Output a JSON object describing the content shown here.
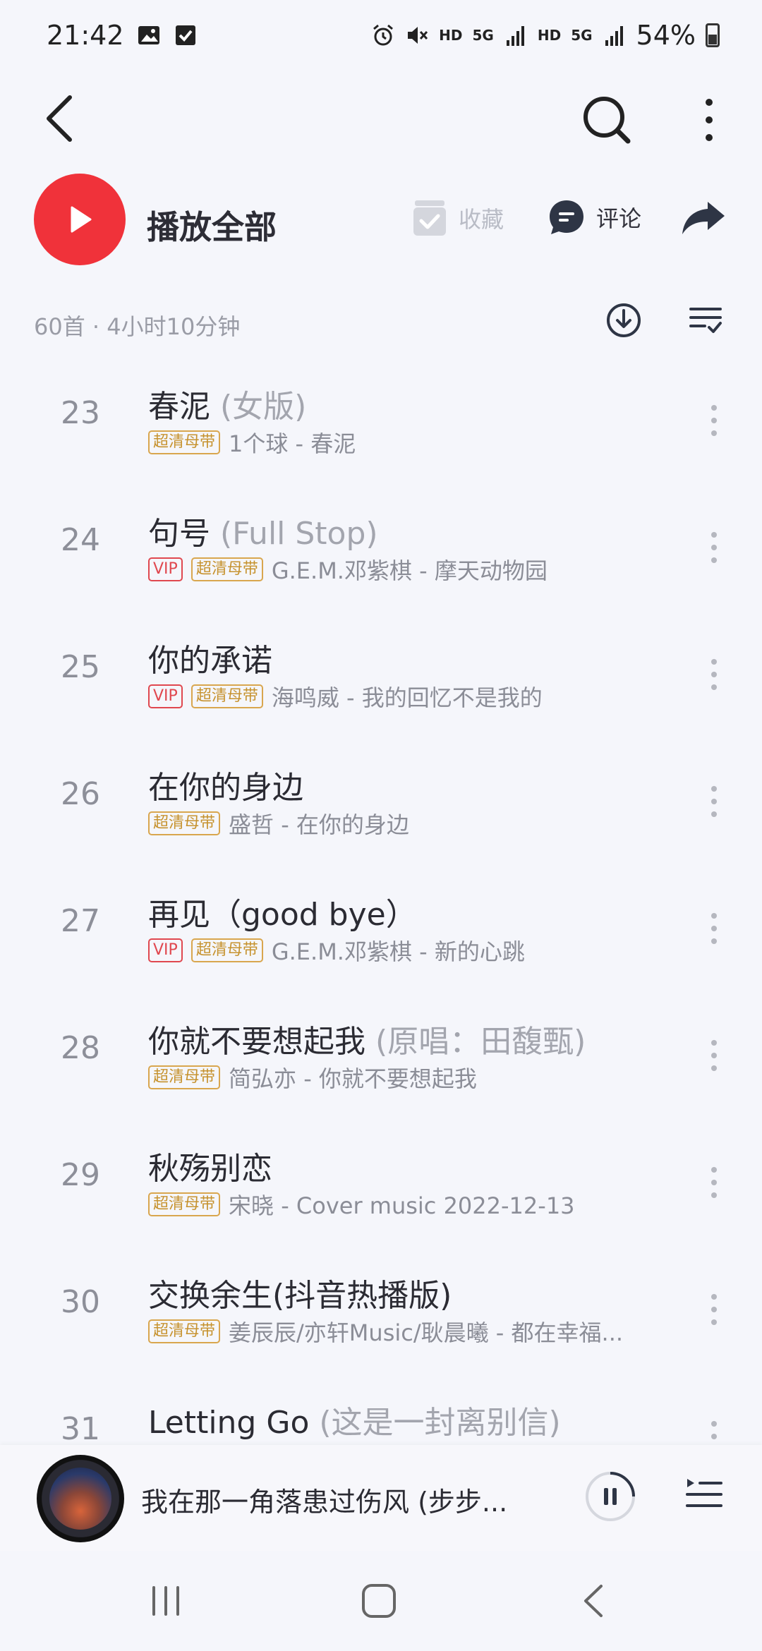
{
  "status_bar": {
    "time": "21:42",
    "network_1": "HD",
    "network_2": "5G",
    "network_3": "HD",
    "network_4": "5G",
    "battery": "54%",
    "icons": [
      "image-icon",
      "check-box-icon",
      "alarm-icon",
      "mute-icon",
      "signal-icon",
      "battery-icon"
    ]
  },
  "top_nav": {
    "back_icon": "back-arrow-icon",
    "search_icon": "search-icon",
    "more_icon": "more-vertical-icon"
  },
  "actions": {
    "play_all": "播放全部",
    "favorite": "收藏",
    "comment": "评论"
  },
  "meta": {
    "summary": "60首 · 4小时10分钟"
  },
  "tags": {
    "hq": "超清母带",
    "vip": "VIP"
  },
  "songs": [
    {
      "num": "23",
      "title": "春泥",
      "sub": " (女版)",
      "vip": false,
      "info": "1个球 - 春泥"
    },
    {
      "num": "24",
      "title": "句号",
      "sub": " (Full Stop)",
      "vip": true,
      "info": "G.E.M.邓紫棋 - 摩天动物园"
    },
    {
      "num": "25",
      "title": "你的承诺",
      "sub": "",
      "vip": true,
      "info": "海鸣威 - 我的回忆不是我的"
    },
    {
      "num": "26",
      "title": "在你的身边",
      "sub": "",
      "vip": false,
      "info": "盛哲 - 在你的身边"
    },
    {
      "num": "27",
      "title": "再见（good bye）",
      "sub": "",
      "vip": true,
      "info": "G.E.M.邓紫棋 - 新的心跳"
    },
    {
      "num": "28",
      "title": "你就不要想起我",
      "sub": " (原唱：田馥甄)",
      "vip": false,
      "info": "简弘亦 - 你就不要想起我"
    },
    {
      "num": "29",
      "title": "秋殇别恋",
      "sub": "",
      "vip": false,
      "info": "宋晓 - Cover music 2022-12-13"
    },
    {
      "num": "30",
      "title": "交换余生(抖音热播版)",
      "sub": "",
      "vip": false,
      "info": "姜辰辰/亦轩Music/耿晨曦 - 都在幸福..."
    },
    {
      "num": "31",
      "title": "Letting Go",
      "sub": " (这是一封离别信)",
      "vip": false,
      "info": ""
    }
  ],
  "mini_player": {
    "title": "我在那一角落患过伤风 (步步..."
  },
  "colors": {
    "accent": "#f0323a",
    "background": "#f5f6fb",
    "hq_tag": "#c6922e",
    "vip_tag": "#e0484f"
  }
}
